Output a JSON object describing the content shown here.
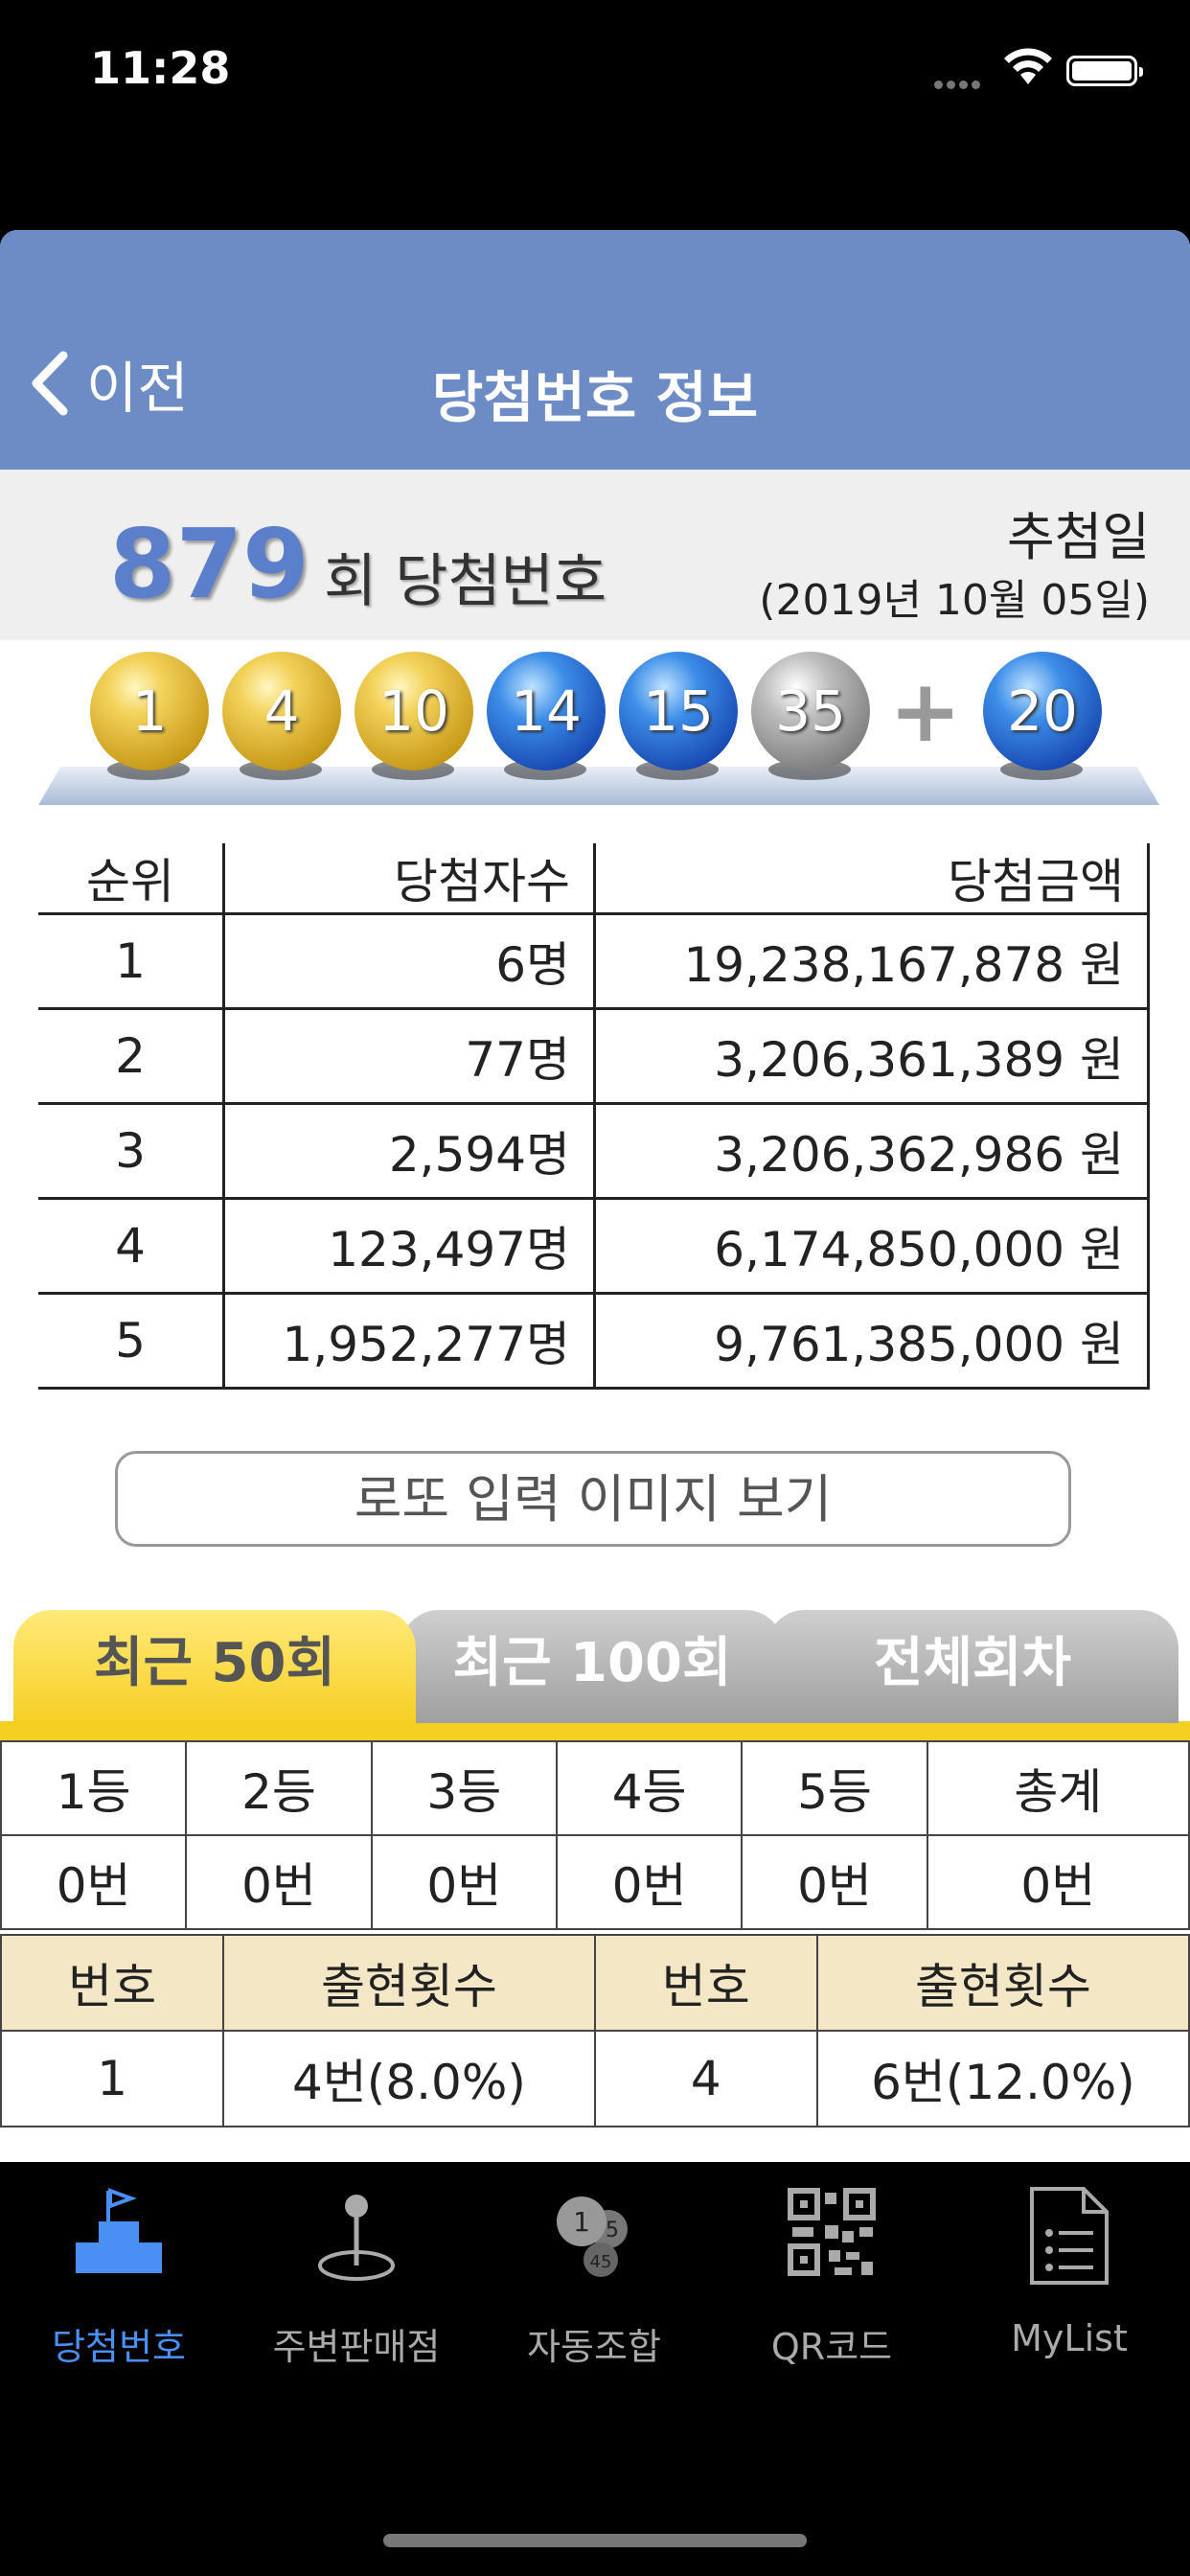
{
  "status_bar": {
    "time": "11:28"
  },
  "nav": {
    "back_label": "이전",
    "title": "당첨번호 정보"
  },
  "round": {
    "number": "879",
    "label": "회 당첨번호",
    "draw_label": "추첨일",
    "draw_date": "(2019년 10월 05일)"
  },
  "balls": {
    "numbers": [
      {
        "value": "1",
        "color": "yellow"
      },
      {
        "value": "4",
        "color": "yellow"
      },
      {
        "value": "10",
        "color": "yellow"
      },
      {
        "value": "14",
        "color": "blue"
      },
      {
        "value": "15",
        "color": "blue"
      },
      {
        "value": "35",
        "color": "gray"
      }
    ],
    "plus": "+",
    "bonus": {
      "value": "20",
      "color": "blue"
    }
  },
  "prize_table": {
    "headers": [
      "순위",
      "당첨자수",
      "당첨금액"
    ],
    "rows": [
      [
        "1",
        "6명",
        "19,238,167,878 원"
      ],
      [
        "2",
        "77명",
        "3,206,361,389 원"
      ],
      [
        "3",
        "2,594명",
        "3,206,362,986 원"
      ],
      [
        "4",
        "123,497명",
        "6,174,850,000 원"
      ],
      [
        "5",
        "1,952,277명",
        "9,761,385,000 원"
      ]
    ]
  },
  "image_button": "로또 입력 이미지 보기",
  "tabs": [
    "최근 50회",
    "최근 100회",
    "전체회차"
  ],
  "rank_stats": {
    "headers": [
      "1등",
      "2등",
      "3등",
      "4등",
      "5등",
      "총계"
    ],
    "values": [
      "0번",
      "0번",
      "0번",
      "0번",
      "0번",
      "0번"
    ]
  },
  "frequency": {
    "headers": [
      "번호",
      "출현횟수",
      "번호",
      "출현횟수"
    ],
    "rows": [
      [
        "1",
        "4번(8.0%)",
        "4",
        "6번(12.0%)"
      ]
    ]
  },
  "tabbar": [
    {
      "label": "당첨번호",
      "icon": "winning-numbers-icon",
      "active": true
    },
    {
      "label": "주변판매점",
      "icon": "map-pin-icon",
      "active": false
    },
    {
      "label": "자동조합",
      "icon": "lotto-balls-icon",
      "active": false
    },
    {
      "label": "QR코드",
      "icon": "qr-code-icon",
      "active": false
    },
    {
      "label": "MyList",
      "icon": "document-list-icon",
      "active": false
    }
  ],
  "tabbar_icon_text": {
    "ball_1": "1",
    "ball_2": "5",
    "ball_3": "45"
  },
  "colors": {
    "nav_blue": "#6d8bc5",
    "tab_yellow": "#f6cf23",
    "active_tab_icon": "#4a90f4"
  }
}
